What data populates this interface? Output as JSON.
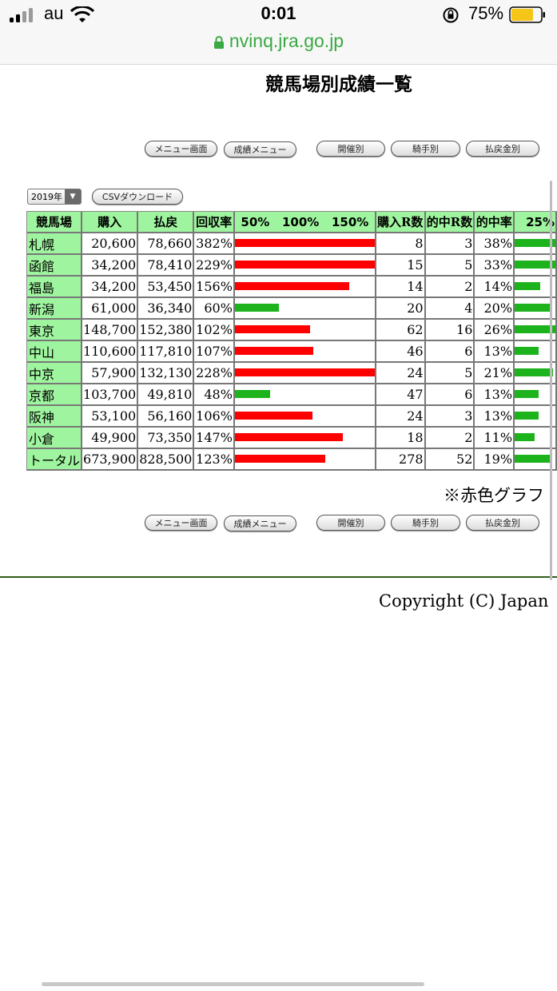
{
  "status": {
    "carrier": "au",
    "time": "0:01",
    "battery": "75%",
    "battery_level": 0.75,
    "url": "nvinq.jra.go.jp",
    "colors": {
      "url": "#3aa843",
      "battery_fill": "#f5c518"
    }
  },
  "page": {
    "title": "競馬場別成績一覧",
    "note": "※赤色グラフ",
    "copyright": "Copyright (C) Japan"
  },
  "nav": {
    "menu": "メニュー画面",
    "results_menu": "成績メニュー",
    "by_meeting": "開催別",
    "by_jockey": "騎手別",
    "by_payout": "払戻金別"
  },
  "controls": {
    "year": "2019年",
    "csv": "CSVダウンロード"
  },
  "table": {
    "headers": {
      "venue": "競馬場",
      "purchase": "購入",
      "payout": "払戻",
      "recovery": "回収率",
      "scale": "50%   100%   150%",
      "races_bought": "購入R数",
      "races_hit": "的中R数",
      "hit_rate": "的中率",
      "hit_scale": "25%"
    },
    "rows": [
      {
        "venue": "札幌",
        "purchase": "20,600",
        "payout": "78,660",
        "recovery": "382%",
        "recovery_value": 382,
        "races": "8",
        "hits": "3",
        "hit_rate": "38%",
        "hit_value": 38
      },
      {
        "venue": "函館",
        "purchase": "34,200",
        "payout": "78,410",
        "recovery": "229%",
        "recovery_value": 229,
        "races": "15",
        "hits": "5",
        "hit_rate": "33%",
        "hit_value": 33
      },
      {
        "venue": "福島",
        "purchase": "34,200",
        "payout": "53,450",
        "recovery": "156%",
        "recovery_value": 156,
        "races": "14",
        "hits": "2",
        "hit_rate": "14%",
        "hit_value": 14
      },
      {
        "venue": "新潟",
        "purchase": "61,000",
        "payout": "36,340",
        "recovery": "60%",
        "recovery_value": 60,
        "races": "20",
        "hits": "4",
        "hit_rate": "20%",
        "hit_value": 20
      },
      {
        "venue": "東京",
        "purchase": "148,700",
        "payout": "152,380",
        "recovery": "102%",
        "recovery_value": 102,
        "races": "62",
        "hits": "16",
        "hit_rate": "26%",
        "hit_value": 26
      },
      {
        "venue": "中山",
        "purchase": "110,600",
        "payout": "117,810",
        "recovery": "107%",
        "recovery_value": 107,
        "races": "46",
        "hits": "6",
        "hit_rate": "13%",
        "hit_value": 13
      },
      {
        "venue": "中京",
        "purchase": "57,900",
        "payout": "132,130",
        "recovery": "228%",
        "recovery_value": 228,
        "races": "24",
        "hits": "5",
        "hit_rate": "21%",
        "hit_value": 21
      },
      {
        "venue": "京都",
        "purchase": "103,700",
        "payout": "49,810",
        "recovery": "48%",
        "recovery_value": 48,
        "races": "47",
        "hits": "6",
        "hit_rate": "13%",
        "hit_value": 13
      },
      {
        "venue": "阪神",
        "purchase": "53,100",
        "payout": "56,160",
        "recovery": "106%",
        "recovery_value": 106,
        "races": "24",
        "hits": "3",
        "hit_rate": "13%",
        "hit_value": 13
      },
      {
        "venue": "小倉",
        "purchase": "49,900",
        "payout": "73,350",
        "recovery": "147%",
        "recovery_value": 147,
        "races": "18",
        "hits": "2",
        "hit_rate": "11%",
        "hit_value": 11
      },
      {
        "venue": "トータル",
        "purchase": "673,900",
        "payout": "828,500",
        "recovery": "123%",
        "recovery_value": 123,
        "races": "278",
        "hits": "52",
        "hit_rate": "19%",
        "hit_value": 19
      }
    ],
    "colors": {
      "header_bg": "#9ff59f",
      "bar_profit": "#ff0000",
      "bar_loss": "#1db31d"
    }
  }
}
